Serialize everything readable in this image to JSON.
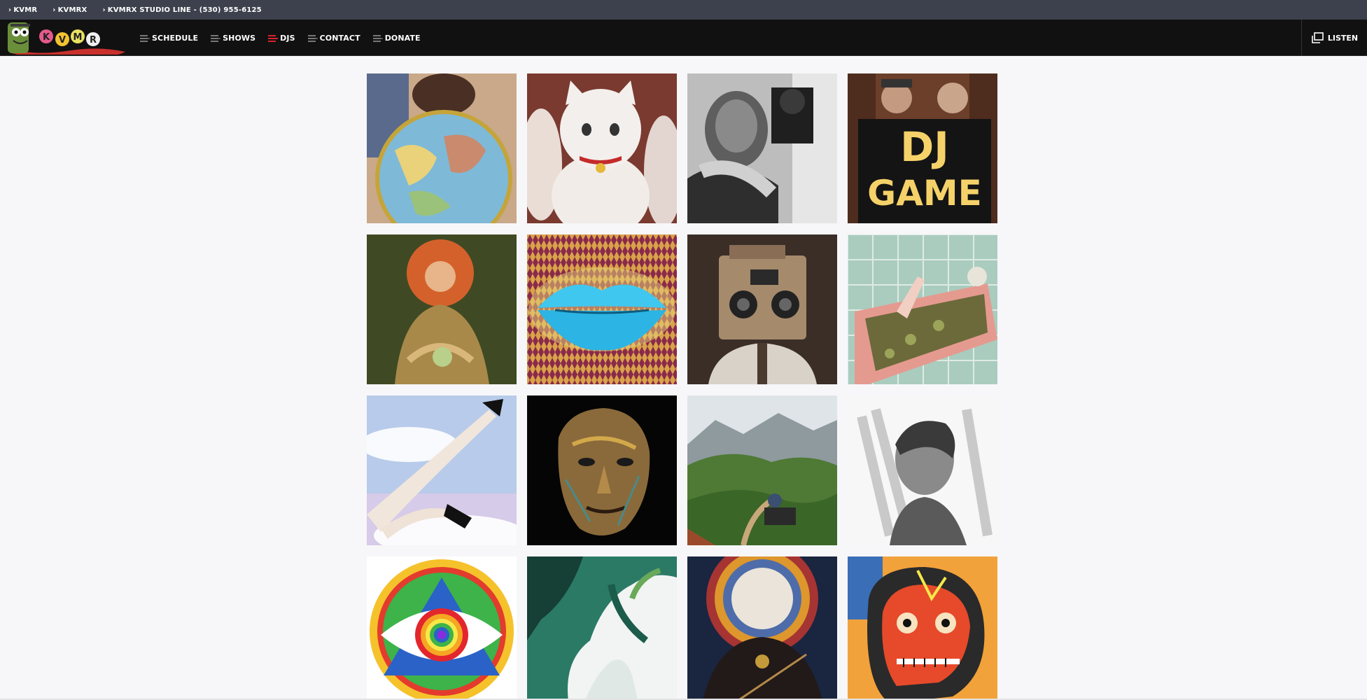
{
  "topbar": {
    "links": [
      {
        "label": "KVMR"
      },
      {
        "label": "KVMRX"
      },
      {
        "label": "KVMRX STUDIO LINE - (530) 955-6125"
      }
    ]
  },
  "logo": {
    "letters": [
      "K",
      "V",
      "M",
      "R"
    ]
  },
  "nav": {
    "items": [
      {
        "label": "SCHEDULE",
        "icon": "list-icon"
      },
      {
        "label": "SHOWS",
        "icon": "list-icon"
      },
      {
        "label": "DJS",
        "icon": "list-icon",
        "active": true
      },
      {
        "label": "CONTACT",
        "icon": "list-icon"
      },
      {
        "label": "DONATE",
        "icon": "list-icon"
      }
    ],
    "listen_label": "LISTEN",
    "active_color": "#d6232f"
  },
  "grid": {
    "tiles": [
      {
        "subject": "globe"
      },
      {
        "subject": "lucky cat"
      },
      {
        "subject": "man with camera"
      },
      {
        "subject": "DJ GAME sign",
        "sign_line1": "DJ",
        "sign_line2": "GAME"
      },
      {
        "subject": "red-haired woman"
      },
      {
        "subject": "blue lips"
      },
      {
        "subject": "robot head"
      },
      {
        "subject": "bathtub"
      },
      {
        "subject": "legs in clouds"
      },
      {
        "subject": "golden face"
      },
      {
        "subject": "mountain landscape"
      },
      {
        "subject": "man portrait"
      },
      {
        "subject": "eye mandala"
      },
      {
        "subject": "marble swirl"
      },
      {
        "subject": "figure with flower head"
      },
      {
        "subject": "skull painting"
      }
    ]
  }
}
